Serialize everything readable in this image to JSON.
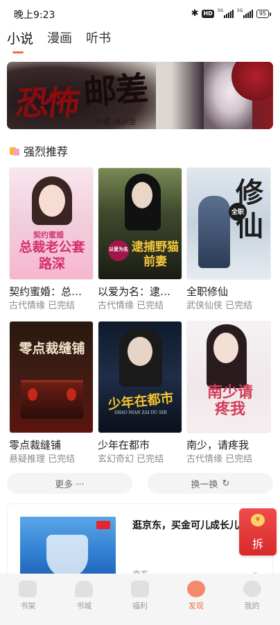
{
  "status": {
    "time": "晚上9:23",
    "hd": "HD",
    "net1": "5G",
    "net2": "5G",
    "battery": "95"
  },
  "tabs": [
    {
      "label": "小说",
      "active": true
    },
    {
      "label": "漫画",
      "active": false
    },
    {
      "label": "听书",
      "active": false
    }
  ],
  "banner": {
    "title_part1": "恐怖",
    "title_part2": "邮差",
    "subtitle": "作者:沐小至"
  },
  "section": {
    "title": "强烈推荐"
  },
  "books": [
    {
      "title": "契约蜜婚：总…",
      "category": "古代情缘",
      "status": "已完结",
      "cover_text": "总裁老公套路深",
      "cover_sub": "契约蜜婚"
    },
    {
      "title": "以爱为名：逮…",
      "category": "古代情缘",
      "status": "已完结",
      "cover_text": "逮捕野猫前妻",
      "cover_sub": "以爱为名"
    },
    {
      "title": "全职修仙",
      "category": "武侠仙侠",
      "status": "已完结",
      "cover_text": "修仙",
      "cover_sub": "全职"
    },
    {
      "title": "零点裁缝铺",
      "category": "悬疑推理",
      "status": "已完结",
      "cover_text": "零点裁缝铺",
      "cover_sub": ""
    },
    {
      "title": "少年在都市",
      "category": "玄幻奇幻",
      "status": "已完结",
      "cover_text": "少年在都市",
      "cover_sub": "SHAO NIAN ZAI DU SHI"
    },
    {
      "title": "南少，请疼我",
      "category": "古代情缘",
      "status": "已完结",
      "cover_text": "南少请疼我",
      "cover_sub": ""
    }
  ],
  "actions": {
    "more": "更多 ···",
    "refresh": "换一换"
  },
  "ad": {
    "title": "逛京东，买金可儿成长儿",
    "source": "京东",
    "chevron": "⌄"
  },
  "redpacket": {
    "coin": "¥",
    "label": "拆"
  },
  "nav": [
    {
      "label": "书架",
      "icon": "bookshelf-icon",
      "active": false
    },
    {
      "label": "书城",
      "icon": "bookstore-icon",
      "active": false
    },
    {
      "label": "福利",
      "icon": "gift-icon",
      "active": false
    },
    {
      "label": "发现",
      "icon": "discover-icon",
      "active": true
    },
    {
      "label": "我的",
      "icon": "profile-icon",
      "active": false
    }
  ],
  "colors": {
    "accent": "#f26f3f",
    "text": "#1d1d1d",
    "muted": "#8a8a8a"
  }
}
